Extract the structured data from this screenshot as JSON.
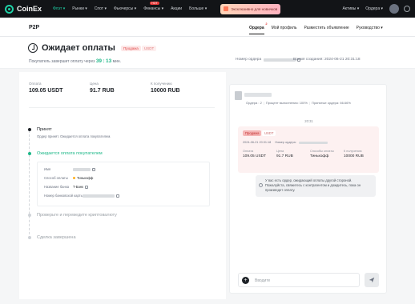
{
  "topnav": {
    "brand": "CoinEx",
    "items": [
      "Флэт ▾",
      "Рынки ▾",
      "Спот ▾",
      "Фьючерсы ▾",
      "Финансы ▾",
      "Акции",
      "Больше ▾"
    ],
    "hot_badge": "HOT",
    "promo": "Эксклюзивно для новичков",
    "right_items": [
      "Активы ▾",
      "Ордера ▾"
    ]
  },
  "subnav": {
    "title": "P2P",
    "tabs": [
      {
        "label": "Ордера",
        "badge": "2"
      },
      {
        "label": "Мой профиль"
      },
      {
        "label": "Разместить объявление"
      },
      {
        "label": "Руководство ▾"
      }
    ]
  },
  "header": {
    "status": "Ожидает оплаты",
    "badge_side": "Продажа",
    "badge_asset": "USDT",
    "countdown_prefix": "Покупатель завершит оплату через",
    "countdown_min": "39",
    "countdown_sep": ":",
    "countdown_sec": "13",
    "countdown_suffix": "мин.",
    "order_label": "Номер ордера",
    "created": "Время создания: 2024-06-21 20:31:18"
  },
  "summary": [
    {
      "label": "Оплата",
      "value": "109.05 USDT"
    },
    {
      "label": "Цена",
      "value": "91.7 RUB"
    },
    {
      "label": "К получению",
      "value": "10000 RUB"
    }
  ],
  "steps": [
    {
      "title": "Принят",
      "desc": "Ордер принят. Ожидается оплата покупателем."
    },
    {
      "title": "Ожидается оплата покупателем"
    },
    {
      "title": "Проверьте и переведите криптовалюту"
    },
    {
      "title": "Сделка завершена"
    }
  ],
  "payment_info": {
    "name_label": "Имя",
    "method_label": "Способ оплаты",
    "method_value": "Тинькофф",
    "bank_label": "Название банка",
    "bank_value": "T-Банк",
    "card_label": "Номер банковской карты"
  },
  "chat": {
    "stats_orders": "Ордера : 2",
    "stats_rate": "Процент выполнения: 100%",
    "stats_accept": "Принятые ордера: 66.66%",
    "date": "20:31",
    "card": {
      "badge_side": "Продажа",
      "badge_asset": "USDT",
      "meta_date": "2024-06-21 20:31:18",
      "meta_order": "Номер ордера:",
      "cols": [
        {
          "label": "Оплата",
          "value": "109.05 USDT"
        },
        {
          "label": "Цена",
          "value": "91.7 RUB"
        },
        {
          "label": "Способы оплаты",
          "value": "Тинькофф"
        },
        {
          "label": "К получению",
          "value": "10000 RUB"
        }
      ]
    },
    "system_message": "У вас есть ордер, ожидающий оплаты другой стороной. Пожалуйста, свяжитесь с контрагентом и дождитесь, пока он произведет оплату.",
    "input_placeholder": "Вводите"
  },
  "colors": {
    "accent": "#1fb889",
    "brand": "#1fd1a6",
    "sell_badge": "#e04848"
  }
}
